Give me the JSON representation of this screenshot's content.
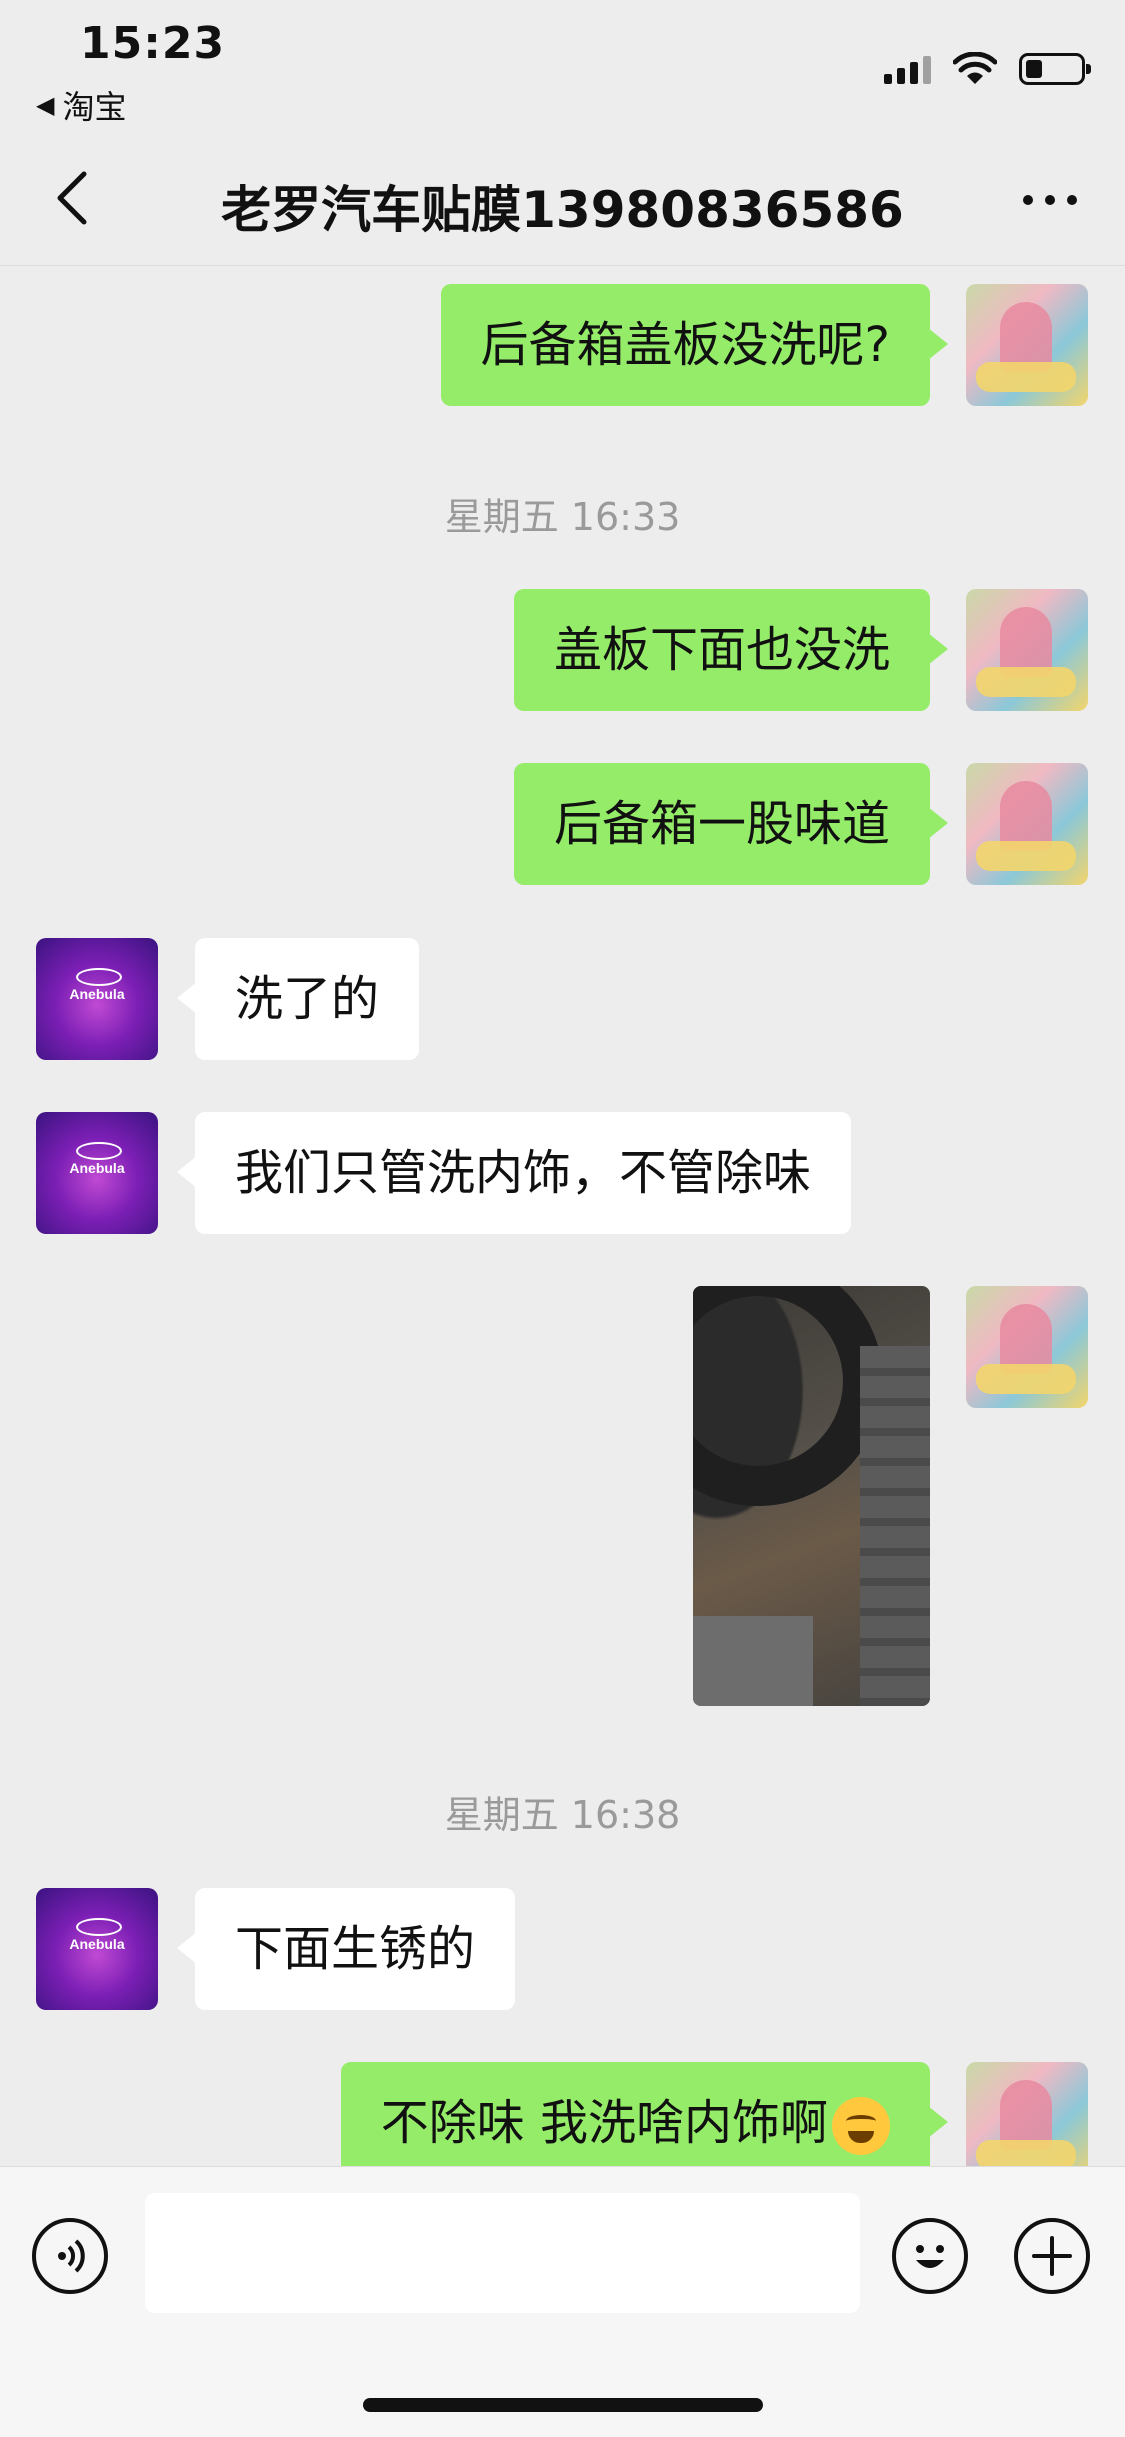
{
  "status_bar": {
    "time": "15:23",
    "back_app": "淘宝",
    "battery_level": 0.3
  },
  "header": {
    "title": "老罗汽车贴膜13980836586"
  },
  "messages": [
    {
      "side": "me",
      "text": "后备箱盖板没洗呢?"
    },
    {
      "timestamp": "星期五 16:33"
    },
    {
      "side": "me",
      "text": "盖板下面也没洗"
    },
    {
      "side": "me",
      "text": "后备箱一股味道"
    },
    {
      "side": "shop",
      "text": "洗了的",
      "avatar_brand": "Anebula"
    },
    {
      "side": "shop",
      "text": "我们只管洗内饰，不管除味",
      "avatar_brand": "Anebula"
    },
    {
      "side": "me",
      "type": "image",
      "image_desc": "spare-tire-photo"
    },
    {
      "timestamp": "星期五 16:38"
    },
    {
      "side": "shop",
      "text": "下面生锈的",
      "avatar_brand": "Anebula"
    },
    {
      "side": "me",
      "text": "不除味 我洗啥内饰啊"
    }
  ],
  "input": {
    "placeholder": ""
  },
  "colors": {
    "background": "#EDEDED",
    "my_bubble": "#95EC69",
    "their_bubble": "#FFFFFF",
    "timestamp": "#9A9A9A"
  },
  "icons": [
    "chevron-left-icon",
    "more-icon",
    "voice-icon",
    "emoji-icon",
    "plus-icon",
    "signal-icon",
    "wifi-icon",
    "battery-icon"
  ]
}
